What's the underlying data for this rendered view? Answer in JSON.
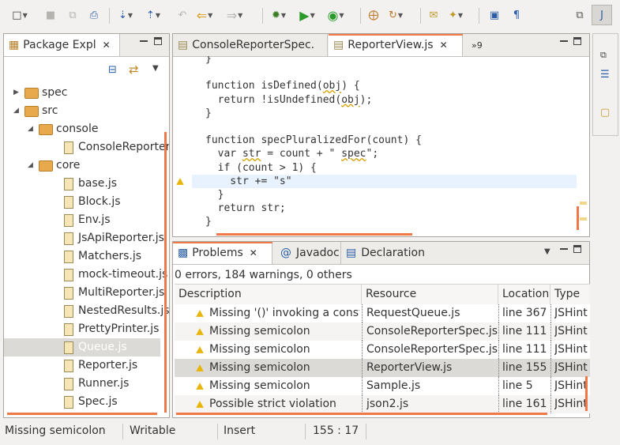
{
  "toolbar": {
    "icons": [
      "new-icon",
      "save-icon",
      "save-all-icon",
      "print-icon",
      "next-annotation-icon",
      "prev-annotation-icon",
      "last-edit-icon",
      "back-icon",
      "forward-icon",
      "debug-icon",
      "run-icon",
      "run-external-icon",
      "new-package-icon",
      "refresh-icon",
      "open-type-icon",
      "search-icon",
      "toggle-view-icon",
      "show-whitespace-icon",
      "open-perspective-icon",
      "js-perspective-icon"
    ]
  },
  "package_explorer": {
    "title": "Package Expl",
    "items": [
      {
        "label": "spec",
        "kind": "folder",
        "depth": 0,
        "expanded": false
      },
      {
        "label": "src",
        "kind": "folder",
        "depth": 0,
        "expanded": true
      },
      {
        "label": "console",
        "kind": "folder",
        "depth": 1,
        "expanded": true
      },
      {
        "label": "ConsoleReporter.js",
        "kind": "file",
        "depth": 2
      },
      {
        "label": "core",
        "kind": "folder",
        "depth": 1,
        "expanded": true
      },
      {
        "label": "base.js",
        "kind": "file",
        "depth": 2
      },
      {
        "label": "Block.js",
        "kind": "file",
        "depth": 2
      },
      {
        "label": "Env.js",
        "kind": "file",
        "depth": 2
      },
      {
        "label": "JsApiReporter.js",
        "kind": "file",
        "depth": 2
      },
      {
        "label": "Matchers.js",
        "kind": "file",
        "depth": 2
      },
      {
        "label": "mock-timeout.js",
        "kind": "file",
        "depth": 2
      },
      {
        "label": "MultiReporter.js",
        "kind": "file",
        "depth": 2
      },
      {
        "label": "NestedResults.js",
        "kind": "file",
        "depth": 2
      },
      {
        "label": "PrettyPrinter.js",
        "kind": "file",
        "depth": 2
      },
      {
        "label": "Queue.js",
        "kind": "file",
        "depth": 2,
        "selected": true
      },
      {
        "label": "Reporter.js",
        "kind": "file",
        "depth": 2
      },
      {
        "label": "Runner.js",
        "kind": "file",
        "depth": 2
      },
      {
        "label": "Spec.js",
        "kind": "file",
        "depth": 2
      }
    ]
  },
  "editor": {
    "tabs": [
      {
        "label": "ConsoleReporterSpec.",
        "active": false
      },
      {
        "label": "ReporterView.js",
        "active": true
      }
    ],
    "overflow_count": "»9",
    "lines": [
      {
        "text": "}"
      },
      {
        "text": ""
      },
      {
        "text": "function isDefined(obj) {"
      },
      {
        "text": "  return !isUndefined(obj);"
      },
      {
        "text": "}"
      },
      {
        "text": ""
      },
      {
        "text": "function specPluralizedFor(count) {"
      },
      {
        "text": "  var str = count + \" spec\";"
      },
      {
        "text": "  if (count > 1) {"
      },
      {
        "text": "    str += \"s\"",
        "current": true,
        "warning": true
      },
      {
        "text": "  }"
      },
      {
        "text": "  return str;"
      },
      {
        "text": "}"
      }
    ]
  },
  "bottom": {
    "tabs": [
      {
        "label": "Problems",
        "active": true
      },
      {
        "label": "Javadoc",
        "active": false
      },
      {
        "label": "Declaration",
        "active": false
      }
    ],
    "summary": "0 errors, 184 warnings, 0 others",
    "columns": [
      "Description",
      "Resource",
      "Location",
      "Type"
    ],
    "rows": [
      {
        "description": "Missing '()' invoking a constructor",
        "resource": "RequestQueue.js",
        "location": "line 367",
        "type": "JSHint"
      },
      {
        "description": "Missing semicolon",
        "resource": "ConsoleReporterSpec.js",
        "location": "line 111",
        "type": "JSHint"
      },
      {
        "description": "Missing semicolon",
        "resource": "ConsoleReporterSpec.js",
        "location": "line 111",
        "type": "JSHint"
      },
      {
        "description": "Missing semicolon",
        "resource": "ReporterView.js",
        "location": "line 155",
        "type": "JSHint",
        "selected": true
      },
      {
        "description": "Missing semicolon",
        "resource": "Sample.js",
        "location": "line 5",
        "type": "JSHint"
      },
      {
        "description": "Possible strict violation",
        "resource": "json2.js",
        "location": "line 161",
        "type": "JSHint"
      }
    ]
  },
  "status": {
    "message": "Missing semicolon",
    "mode": "Writable",
    "insert": "Insert",
    "position": "155 : 17"
  },
  "colors": {
    "accent": "#f07746",
    "warning": "#e8b50a",
    "selection": "#dcdad6"
  }
}
